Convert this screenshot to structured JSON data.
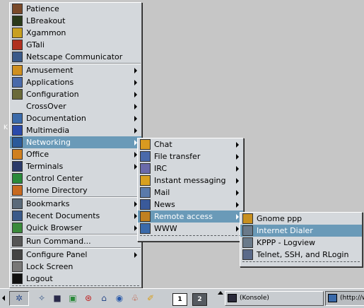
{
  "desktop": {
    "edge_letter": "K"
  },
  "main_menu": {
    "recent_apps": [
      {
        "label": "Patience",
        "icon": "cards-icon",
        "color": "#7a4a2a"
      },
      {
        "label": "LBreakout",
        "icon": "breakout-icon",
        "color": "#2a3a1a"
      },
      {
        "label": "Xgammon",
        "icon": "dice-icon",
        "color": "#c8a020"
      },
      {
        "label": "GTali",
        "icon": "dice-icon",
        "color": "#b03020"
      },
      {
        "label": "Netscape Communicator",
        "icon": "netscape-icon",
        "color": "#3a5a8a"
      }
    ],
    "categories": [
      {
        "label": "Amusement",
        "icon": "game-icon",
        "color": "#d09020",
        "submenu": true
      },
      {
        "label": "Applications",
        "icon": "applications-icon",
        "color": "#4a6aaa",
        "submenu": true
      },
      {
        "label": "Configuration",
        "icon": "settings-icon",
        "color": "#6a6a3a",
        "submenu": true
      },
      {
        "label": "CrossOver",
        "icon": "",
        "color": "",
        "submenu": true
      },
      {
        "label": "Documentation",
        "icon": "help-icon",
        "color": "#3a6aaa",
        "submenu": true
      },
      {
        "label": "Multimedia",
        "icon": "multimedia-icon",
        "color": "#2a4aaa",
        "submenu": true
      },
      {
        "label": "Networking",
        "icon": "network-icon",
        "color": "#2a5a9a",
        "submenu": true
      },
      {
        "label": "Office",
        "icon": "office-icon",
        "color": "#d08020",
        "submenu": true
      },
      {
        "label": "Terminals",
        "icon": "terminal-icon",
        "color": "#2a3a6a",
        "submenu": true
      },
      {
        "label": "Control Center",
        "icon": "control-center-icon",
        "color": "#2a8a3a",
        "submenu": false
      },
      {
        "label": "Home Directory",
        "icon": "home-icon",
        "color": "#c86a20",
        "submenu": false
      }
    ],
    "extras": [
      {
        "label": "Bookmarks",
        "icon": "bookmark-icon",
        "color": "#5a6a7a",
        "submenu": true
      },
      {
        "label": "Recent Documents",
        "icon": "document-icon",
        "color": "#3a5a8a",
        "submenu": true
      },
      {
        "label": "Quick Browser",
        "icon": "browser-icon",
        "color": "#3a8a3a",
        "submenu": true
      }
    ],
    "run": {
      "label": "Run Command...",
      "icon": "run-icon",
      "color": "#555555"
    },
    "system": [
      {
        "label": "Configure Panel",
        "icon": "panel-icon",
        "color": "#444444",
        "submenu": true
      },
      {
        "label": "Lock Screen",
        "icon": "lock-icon",
        "color": "#777777",
        "submenu": false
      },
      {
        "label": "Logout",
        "icon": "logout-icon",
        "color": "#111111",
        "submenu": false
      }
    ]
  },
  "networking_menu": {
    "items": [
      {
        "label": "Chat",
        "icon": "chat-icon",
        "color": "#d89a20",
        "submenu": true
      },
      {
        "label": "File transfer",
        "icon": "file-transfer-icon",
        "color": "#4a6aaa",
        "submenu": true
      },
      {
        "label": "IRC",
        "icon": "irc-icon",
        "color": "#6a6aaa",
        "submenu": true
      },
      {
        "label": "Instant messaging",
        "icon": "messaging-icon",
        "color": "#d8a020",
        "submenu": true
      },
      {
        "label": "Mail",
        "icon": "mail-icon",
        "color": "#5a7aaa",
        "submenu": true
      },
      {
        "label": "News",
        "icon": "news-icon",
        "color": "#3a5a9a",
        "submenu": true
      },
      {
        "label": "Remote access",
        "icon": "remote-access-icon",
        "color": "#c08020",
        "submenu": true
      },
      {
        "label": "WWW",
        "icon": "www-icon",
        "color": "#3a6aaa",
        "submenu": true
      }
    ]
  },
  "remote_menu": {
    "items": [
      {
        "label": "Gnome ppp",
        "icon": "ppp-icon",
        "color": "#c89020"
      },
      {
        "label": "Internet Dialer",
        "icon": "dialer-icon",
        "color": "#6a7a8a"
      },
      {
        "label": "KPPP - Logview",
        "icon": "logview-icon",
        "color": "#6a7a8a"
      },
      {
        "label": "Telnet, SSH, and RLogin",
        "icon": "telnet-icon",
        "color": "#5a6a8a"
      }
    ]
  },
  "taskbar": {
    "quick_launch": [
      {
        "icon": "kde-menu-icon",
        "glyph": "✲",
        "color": "#2a4a8a"
      },
      {
        "icon": "tools-icon",
        "glyph": "✧",
        "color": "#3a5a8a"
      },
      {
        "icon": "terminal-icon",
        "glyph": "■",
        "color": "#2a2a4a"
      },
      {
        "icon": "control-center-icon",
        "glyph": "▣",
        "color": "#2a8a3a"
      },
      {
        "icon": "help-icon",
        "glyph": "⊛",
        "color": "#c02020"
      },
      {
        "icon": "home-icon",
        "glyph": "⌂",
        "color": "#2a4a8a"
      },
      {
        "icon": "browser-icon",
        "glyph": "◉",
        "color": "#2a5aaa"
      },
      {
        "icon": "web-icon",
        "glyph": "♧",
        "color": "#c04020"
      },
      {
        "icon": "editor-icon",
        "glyph": "✐",
        "color": "#d8a020"
      }
    ],
    "desktops": [
      "1",
      "2"
    ],
    "tasks": [
      {
        "label": "(Konsole)",
        "icon": "konsole-icon"
      },
      {
        "label": "(http://w",
        "icon": "browser-window-icon"
      }
    ]
  }
}
